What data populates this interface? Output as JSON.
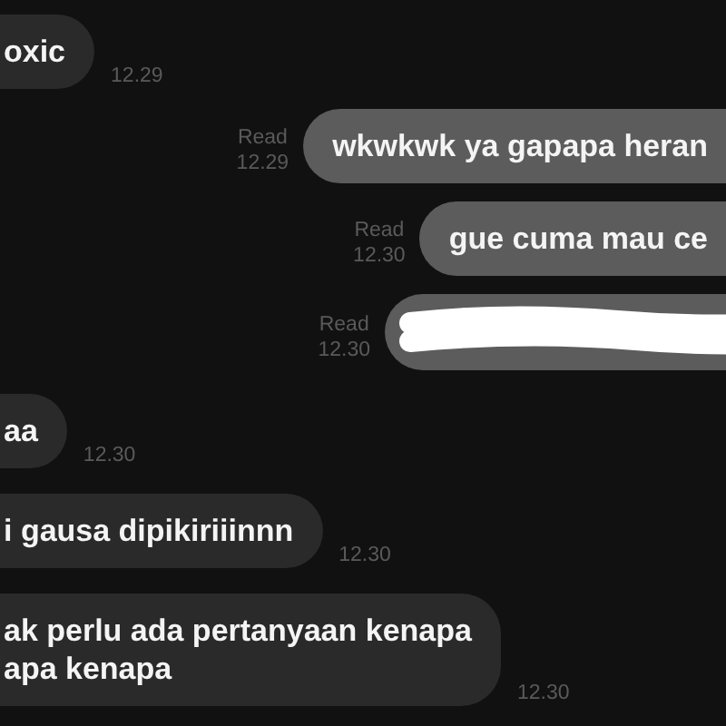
{
  "messages": [
    {
      "kind": "incoming",
      "lines": [
        "oxic"
      ],
      "time": "12.29"
    },
    {
      "kind": "outgoing",
      "lines": [
        "wkwkwk ya gapapa heran"
      ],
      "status": "Read",
      "time": "12.29"
    },
    {
      "kind": "outgoing",
      "lines": [
        "gue cuma mau ce"
      ],
      "status": "Read",
      "time": "12.30"
    },
    {
      "kind": "redacted",
      "status": "Read",
      "time": "12.30"
    },
    {
      "kind": "incoming",
      "lines": [
        "aa"
      ],
      "time": "12.30"
    },
    {
      "kind": "incoming",
      "lines": [
        "i gausa dipikiriiinnn"
      ],
      "time": "12.30"
    },
    {
      "kind": "incoming",
      "lines": [
        "ak perlu ada pertanyaan kenapa",
        "apa kenapa"
      ],
      "time": "12.30"
    }
  ]
}
